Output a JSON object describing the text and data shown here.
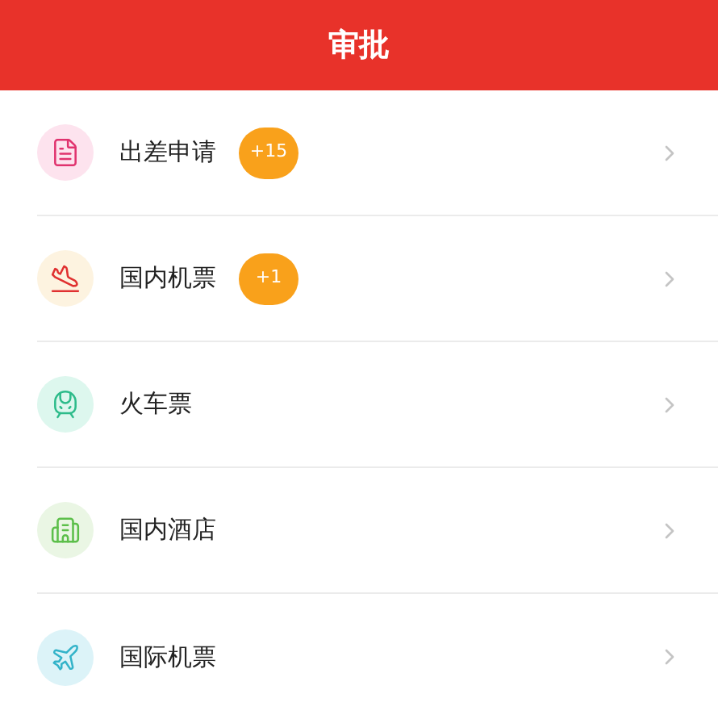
{
  "header": {
    "title": "审批"
  },
  "items": [
    {
      "kind": "trip",
      "label": "出差申请",
      "badge": "+15"
    },
    {
      "kind": "flight",
      "label": "国内机票",
      "badge": "+1"
    },
    {
      "kind": "train",
      "label": "火车票"
    },
    {
      "kind": "hotel",
      "label": "国内酒店"
    },
    {
      "kind": "intl",
      "label": "国际机票"
    }
  ]
}
